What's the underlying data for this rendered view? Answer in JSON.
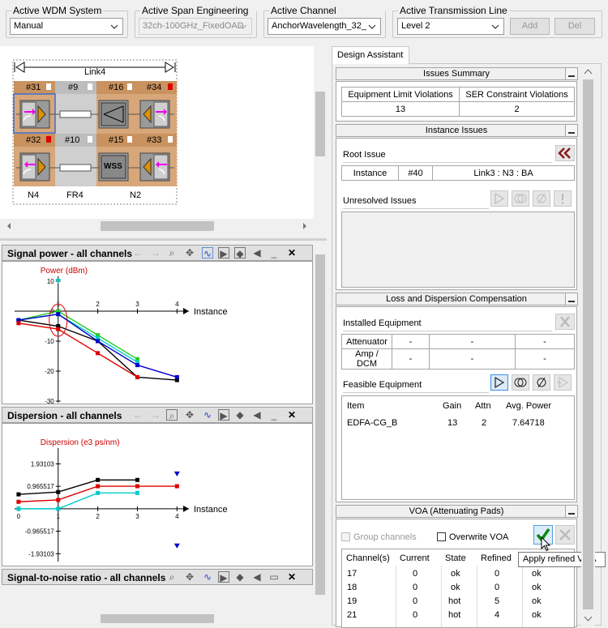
{
  "top": {
    "wdm": {
      "label": "Active WDM System",
      "value": "Manual"
    },
    "span": {
      "label": "Active Span Engineering Rule",
      "value": "32ch-100GHz_FixedOAD"
    },
    "channel": {
      "label": "Active Channel Assignment",
      "value": "AnchorWavelength_32_"
    },
    "transmission": {
      "label": "Active Transmission Line",
      "value": "Level 2"
    },
    "add_label": "Add",
    "del_label": "Del"
  },
  "diagram": {
    "link_label": "Link4",
    "top_row": [
      "#31",
      "#9",
      "#16",
      "#34"
    ],
    "bottom_row": [
      "#32",
      "#10",
      "#15",
      "#33"
    ],
    "wss_label": "WSS",
    "nodes": [
      "N4",
      "FR4",
      "N2"
    ]
  },
  "charts": {
    "signal": {
      "title": "Signal power - all channels"
    },
    "dispersion": {
      "title": "Dispersion - all channels"
    },
    "snr": {
      "title": "Signal-to-noise ratio - all channels"
    }
  },
  "chart_data": [
    {
      "type": "line",
      "title": "Signal power - all channels",
      "ylabel": "Power (dBm)",
      "xlabel": "Instance",
      "x_ticks": [
        "1",
        "2",
        "3",
        "4"
      ],
      "y_ticks": [
        "10",
        "0",
        "-10",
        "-20",
        "-30"
      ],
      "ylim": [
        -30,
        10
      ],
      "xlim": [
        -0.1,
        4.3
      ],
      "series": [
        {
          "color": "#000000",
          "x": [
            0,
            1,
            2,
            3,
            4
          ],
          "y": [
            -3,
            -5,
            -10,
            -22,
            -23
          ]
        },
        {
          "color": "#22cc22",
          "x": [
            0,
            1,
            2,
            3
          ],
          "y": [
            -3,
            0,
            -8,
            -16
          ]
        },
        {
          "color": "#00cccc",
          "x": [
            0,
            1,
            2,
            3
          ],
          "y": [
            -3,
            -1,
            -9,
            -17
          ]
        },
        {
          "color": "#0000cc",
          "x": [
            0,
            1,
            2,
            3,
            4
          ],
          "y": [
            -3,
            -1,
            -10,
            -18,
            -22
          ]
        },
        {
          "color": "#dd0000",
          "x": [
            0,
            1,
            2,
            3
          ],
          "y": [
            -4,
            -6,
            -14,
            -22
          ]
        }
      ],
      "markers": [
        {
          "x": 1,
          "y": 10,
          "color": "#00cccc"
        }
      ]
    },
    {
      "type": "line",
      "title": "Dispersion - all channels",
      "ylabel": "Dispersion (e3 ps/nm)",
      "xlabel": "Instance",
      "x_ticks": [
        "0",
        "1",
        "2",
        "3",
        "4"
      ],
      "y_ticks": [
        "1.93103",
        "0.965517",
        "-0.965517",
        "-1.93103"
      ],
      "ylim": [
        -2.2,
        2.4
      ],
      "xlim": [
        -0.1,
        4.3
      ],
      "series": [
        {
          "color": "#000000",
          "x": [
            0,
            1,
            2,
            3
          ],
          "y": [
            0.62,
            0.72,
            1.24,
            1.24
          ]
        },
        {
          "color": "#dd0000",
          "x": [
            0,
            1,
            2,
            3,
            4
          ],
          "y": [
            0.3,
            0.38,
            0.97,
            0.97,
            0.97
          ]
        },
        {
          "color": "#00cccc",
          "x": [
            0,
            1,
            2,
            3
          ],
          "y": [
            0.0,
            0.0,
            0.68,
            0.68
          ]
        }
      ],
      "markers": [
        {
          "x": 4,
          "y": 1.5,
          "color": "#0000cc"
        },
        {
          "x": 4,
          "y": -1.6,
          "color": "#0000cc"
        }
      ]
    }
  ],
  "assistant": {
    "tab": "Design Assistant",
    "issues_summary": {
      "title": "Issues Summary",
      "headers": [
        "Equipment Limit Violations",
        "SER Constraint Violations"
      ],
      "values": [
        "13",
        "2"
      ]
    },
    "instance_issues": {
      "title": "Instance Issues",
      "root_label": "Root Issue",
      "instance_label": "Instance",
      "instance_id": "#40",
      "instance_link": "Link3 : N3 : BA",
      "unresolved_label": "Unresolved Issues"
    },
    "loss": {
      "title": "Loss and Dispersion Compensation",
      "installed_label": "Installed Equipment",
      "installed_rows": [
        {
          "name": "Attenuator",
          "a": "-",
          "b": "-",
          "c": "-"
        },
        {
          "name": "Amp / DCM",
          "a": "-",
          "b": "-",
          "c": "-"
        }
      ],
      "feasible_label": "Feasible Equipment",
      "columns": [
        "Item",
        "Gain",
        "Attn",
        "Avg. Power"
      ],
      "rows": [
        {
          "item": "EDFA-CG_B",
          "gain": "13",
          "attn": "2",
          "power": "7.64718"
        }
      ]
    },
    "voa": {
      "title": "VOA (Attenuating Pads)",
      "group_label": "Group channels",
      "overwrite_label": "Overwrite VOA",
      "tooltip": "Apply refined VOA",
      "columns": [
        "Channel(s)",
        "Current",
        "State",
        "Refined",
        "ok"
      ],
      "rows": [
        {
          "ch": "17",
          "cur": "0",
          "state": "ok",
          "ref": "0",
          "ok": "ok"
        },
        {
          "ch": "18",
          "cur": "0",
          "state": "ok",
          "ref": "0",
          "ok": "ok"
        },
        {
          "ch": "19",
          "cur": "0",
          "state": "hot",
          "ref": "5",
          "ok": "ok"
        },
        {
          "ch": "21",
          "cur": "0",
          "state": "hot",
          "ref": "4",
          "ok": "ok"
        }
      ]
    }
  }
}
